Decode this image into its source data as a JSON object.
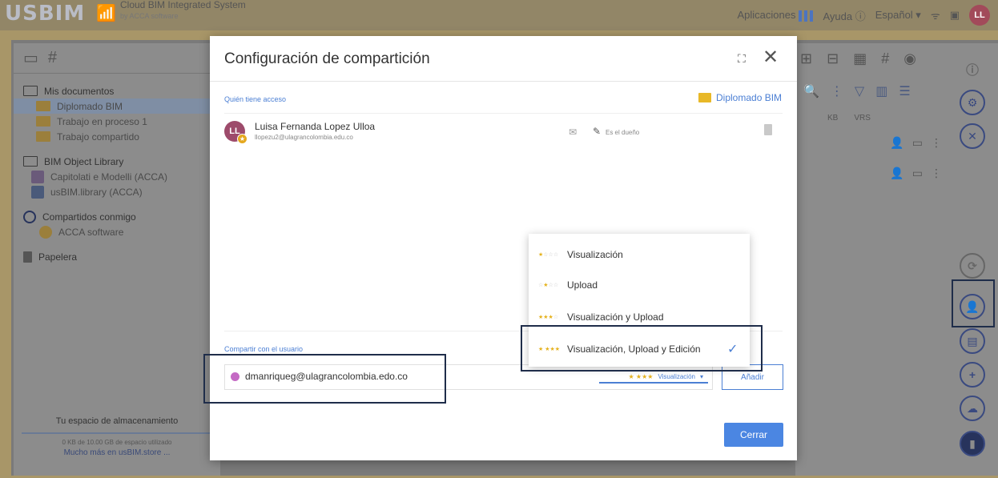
{
  "topbar": {
    "logo": "USBIM",
    "brand_title": "Cloud BIM Integrated System",
    "brand_sub": "by ACCA software",
    "apps_label": "Aplicaciones",
    "help_label": "Ayuda ⓘ",
    "language": "Español ▾",
    "avatar": "LL"
  },
  "sidebar": {
    "my_docs": "Mis documentos",
    "folder_selected": "Diplomado BIM",
    "folder_1": "Trabajo en proceso 1",
    "folder_2": "Trabajo compartido",
    "library": "BIM Object Library",
    "lib_1": "Capitolati e Modelli (ACCA)",
    "lib_2": "usBIM.library (ACCA)",
    "shared": "Compartidos conmigo",
    "shared_1": "ACCA software",
    "trash": "Papelera",
    "storage_title": "Tu espacio de almacenamiento",
    "storage_used": "0 KB de 10.00 GB de espacio utilizado",
    "storage_link": "Mucho más en usBIM.store ..."
  },
  "files_panel": {
    "col_kb": "KB",
    "col_vrs": "VRS"
  },
  "modal": {
    "title": "Configuración de compartición",
    "access_label": "Quién tiene acceso",
    "folder_name": "Diplomado BIM",
    "user_name": "Luisa Fernanda Lopez Ulloa",
    "user_email": "llopezu2@ulagrancolombia.edu.co",
    "user_initials": "LL",
    "owner_label": "Es el dueño",
    "share_label": "Compartir con el usuario",
    "share_email": "dmanriqueg@ulagrancolombia.edo.co",
    "perm_selected": "Visualización",
    "add_button": "Añadir",
    "close_button": "Cerrar"
  },
  "dropdown": {
    "items": [
      {
        "label": "Visualización",
        "stars_on": 1
      },
      {
        "label": "Upload",
        "stars_on": 2
      },
      {
        "label": "Visualización y Upload",
        "stars_on": 3
      },
      {
        "label": "Visualización, Upload y Edición",
        "stars_on": 4,
        "checked": true
      }
    ]
  },
  "colors": {
    "accent": "#4b7fd4",
    "star": "#e5b21e",
    "highlight": "#1f2d4a"
  }
}
